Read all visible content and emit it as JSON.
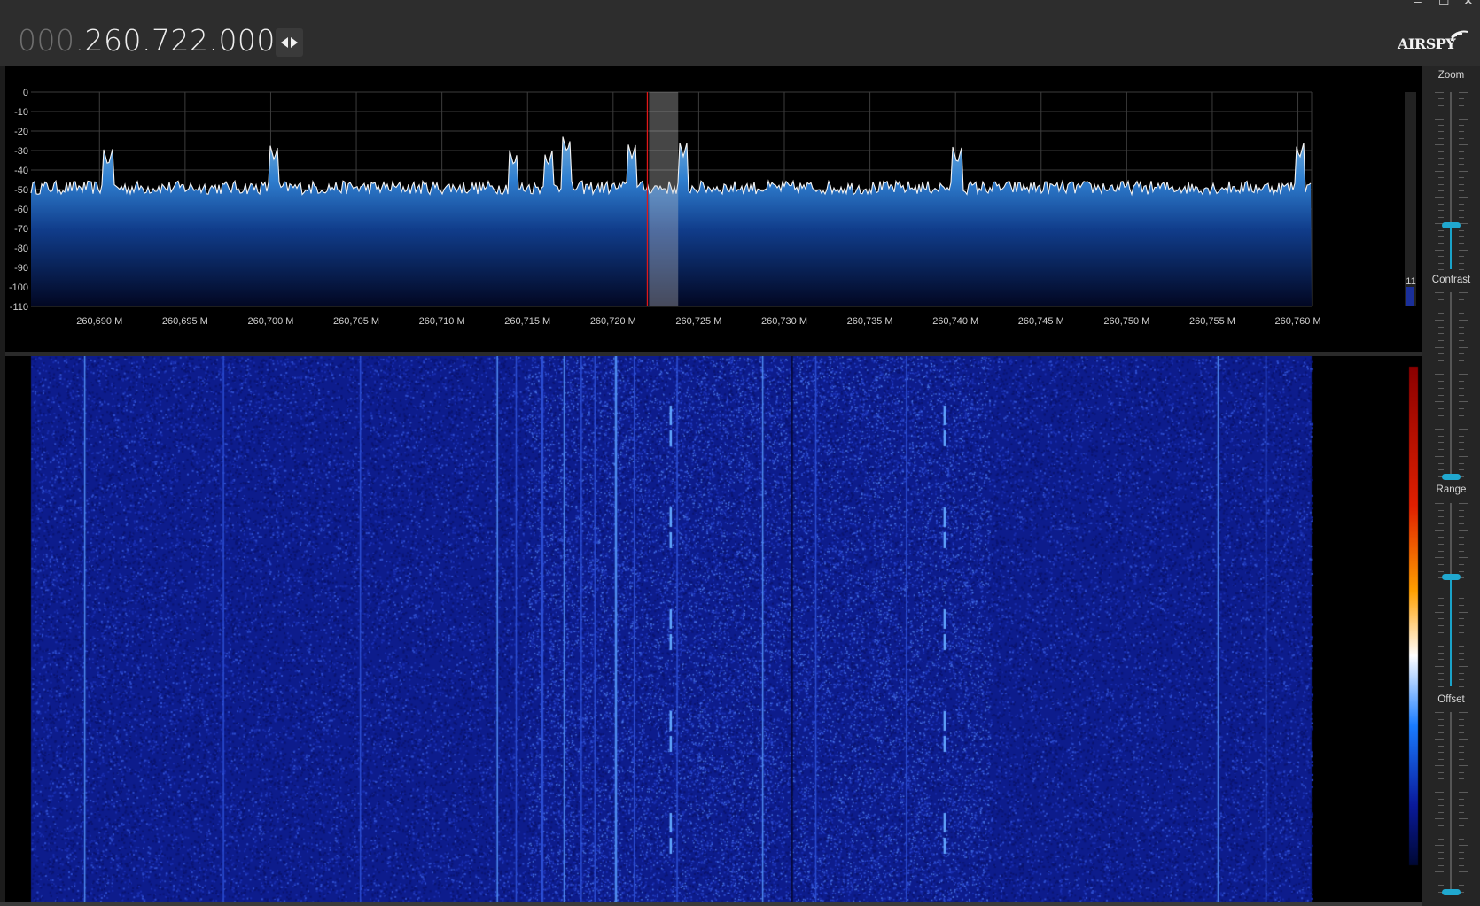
{
  "window": {
    "minimize_glyph": "–",
    "maximize_glyph": "☐",
    "close_glyph": "✕"
  },
  "frequency": {
    "dim_part": "000.",
    "main_part": "260.722.000"
  },
  "logo": {
    "text": "AIRSPY"
  },
  "spectrum": {
    "db_labels": [
      "0",
      "-10",
      "-20",
      "-30",
      "-40",
      "-50",
      "-60",
      "-70",
      "-80",
      "-90",
      "-100",
      "-110"
    ],
    "freq_labels": [
      "260,690 M",
      "260,695 M",
      "260,700 M",
      "260,705 M",
      "260,710 M",
      "260,715 M",
      "260,720 M",
      "260,725 M",
      "260,730 M",
      "260,735 M",
      "260,740 M",
      "260,745 M",
      "260,750 M",
      "260,755 M",
      "260,760 M"
    ],
    "noise_floor_db": -45,
    "peaks": [
      {
        "freq_mhz": 260.6905,
        "db": -38
      },
      {
        "freq_mhz": 260.7002,
        "db": -35
      },
      {
        "freq_mhz": 260.7142,
        "db": -38
      },
      {
        "freq_mhz": 260.7162,
        "db": -38
      },
      {
        "freq_mhz": 260.7173,
        "db": -31
      },
      {
        "freq_mhz": 260.7211,
        "db": -34
      },
      {
        "freq_mhz": 260.7241,
        "db": -33
      },
      {
        "freq_mhz": 260.7401,
        "db": -37
      },
      {
        "freq_mhz": 260.7601,
        "db": -34
      }
    ],
    "tuned_freq_mhz": 260.722,
    "filter_band_mhz": [
      260.7221,
      260.7238
    ],
    "level_meter_value": "11"
  },
  "waterfall": {
    "carriers_mhz": [
      260.6891,
      260.6972,
      260.7052,
      260.7132,
      260.7143,
      260.7158,
      260.7171,
      260.7181,
      260.7189,
      260.7201,
      260.7212,
      260.7237,
      260.7287,
      260.7318,
      260.7371,
      260.7553,
      260.7581
    ]
  },
  "controls": {
    "zoom_label": "Zoom",
    "contrast_label": "Contrast",
    "range_label": "Range",
    "offset_label": "Offset",
    "zoom_value": 0.25,
    "contrast_value": 0.0,
    "range_value": 0.6,
    "offset_value": 0.0
  }
}
